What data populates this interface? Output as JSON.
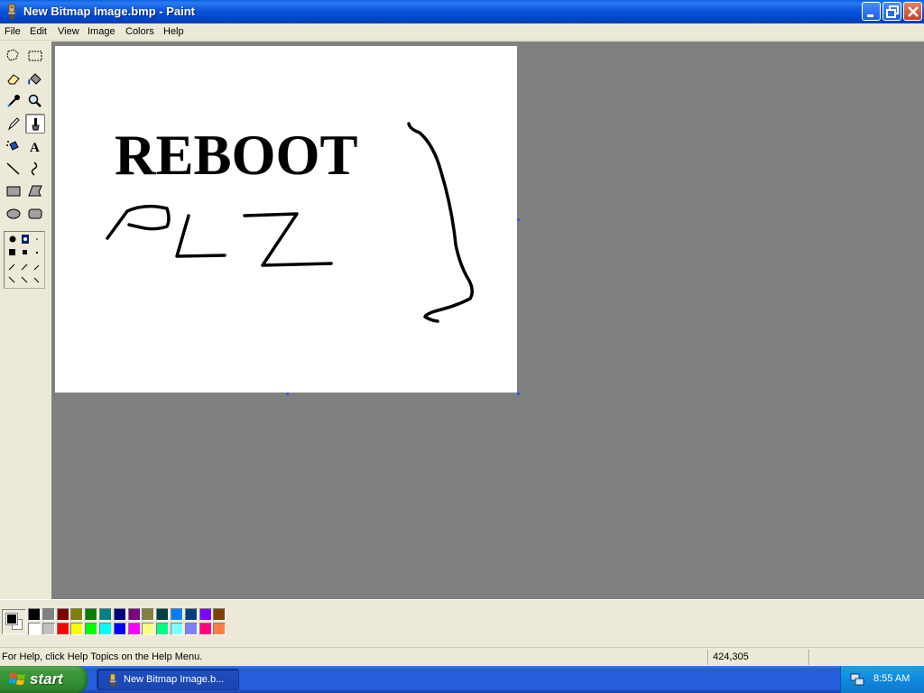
{
  "window": {
    "title": "New Bitmap Image.bmp - Paint"
  },
  "menu": {
    "items": [
      "File",
      "Edit",
      "View",
      "Image",
      "Colors",
      "Help"
    ]
  },
  "toolbox": {
    "tools": [
      "free-form-select-icon",
      "rect-select-icon",
      "eraser-icon",
      "fill-bucket-icon",
      "color-picker-icon",
      "magnifier-icon",
      "pencil-icon",
      "brush-icon",
      "airbrush-icon",
      "text-icon",
      "line-icon",
      "curve-icon",
      "rectangle-icon",
      "polygon-icon",
      "ellipse-icon",
      "rounded-rect-icon"
    ],
    "active_tool": "brush-icon"
  },
  "canvas": {
    "text": "REBOOT",
    "handwritten": "PLZ"
  },
  "palette": {
    "foreground": "#000000",
    "background": "#ffffff",
    "row1": [
      "#000000",
      "#808080",
      "#800000",
      "#808000",
      "#008000",
      "#008080",
      "#000080",
      "#800080",
      "#808040",
      "#004040",
      "#0080ff",
      "#004080",
      "#8000ff",
      "#804000"
    ],
    "row2": [
      "#ffffff",
      "#c0c0c0",
      "#ff0000",
      "#ffff00",
      "#00ff00",
      "#00ffff",
      "#0000ff",
      "#ff00ff",
      "#ffff80",
      "#00ff80",
      "#80ffff",
      "#8080ff",
      "#ff0080",
      "#ff8040"
    ]
  },
  "status": {
    "help": "For Help, click Help Topics on the Help Menu.",
    "coords": "424,305"
  },
  "taskbar": {
    "start_label": "start",
    "task_label": "New Bitmap Image.b...",
    "clock": "8:55 AM"
  }
}
